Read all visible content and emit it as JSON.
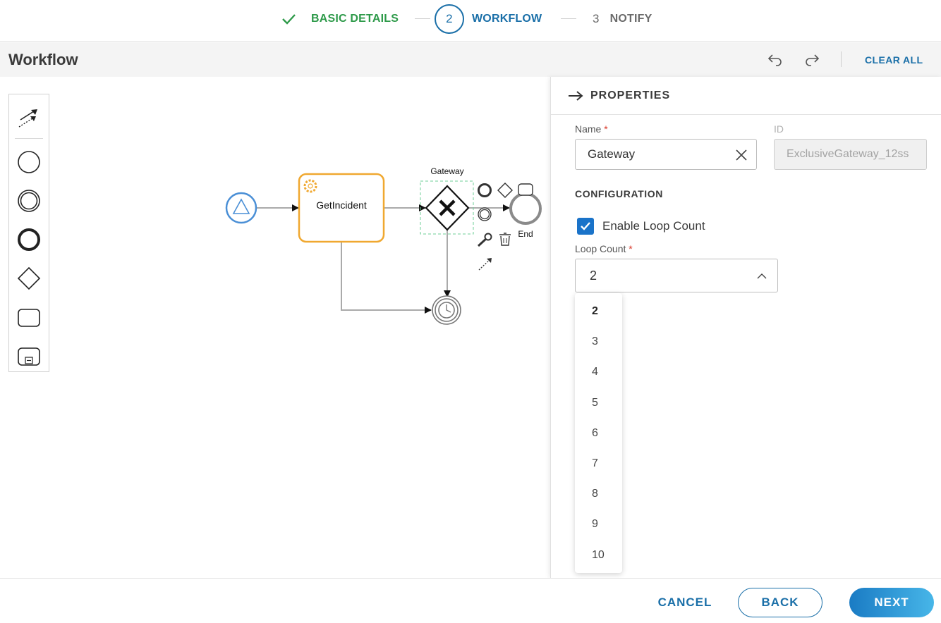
{
  "stepper": {
    "steps": [
      {
        "label": "BASIC DETAILS",
        "state": "completed",
        "color": "#2e9a4a"
      },
      {
        "number": "2",
        "label": "WORKFLOW",
        "state": "active",
        "color": "#1a6fa8"
      },
      {
        "number": "3",
        "label": "NOTIFY",
        "state": "pending",
        "color": "#6b6b6b"
      }
    ]
  },
  "header": {
    "title": "Workflow",
    "undo_icon": "undo-icon",
    "redo_icon": "redo-icon",
    "clear_all_label": "CLEAR ALL"
  },
  "palette": {
    "tools": [
      "connect-tool-icon",
      "start-event-icon",
      "intermediate-event-icon",
      "end-event-icon",
      "gateway-icon",
      "task-icon",
      "subprocess-icon"
    ]
  },
  "diagram": {
    "task_label": "GetIncident",
    "gateway_label": "Gateway",
    "end_label": "End",
    "accent_task": "#f0a830",
    "accent_start": "#4a8fd6",
    "context_pad": [
      "end-event-icon",
      "gateway-icon",
      "task-icon",
      "intermediate-event-icon",
      "wrench-icon",
      "trash-icon",
      "connect-tool-icon"
    ]
  },
  "properties": {
    "title": "PROPERTIES",
    "name_label": "Name",
    "name_value": "Gateway",
    "id_label": "ID",
    "id_value": "ExclusiveGateway_12ss",
    "config_title": "CONFIGURATION",
    "enable_loop_label": "Enable Loop Count",
    "enable_loop_checked": true,
    "loop_count_label": "Loop Count",
    "loop_count_value": "2",
    "required_marker": "*",
    "loop_options": [
      "2",
      "3",
      "4",
      "5",
      "6",
      "7",
      "8",
      "9",
      "10"
    ]
  },
  "footer": {
    "cancel_label": "CANCEL",
    "back_label": "BACK",
    "next_label": "NEXT"
  }
}
